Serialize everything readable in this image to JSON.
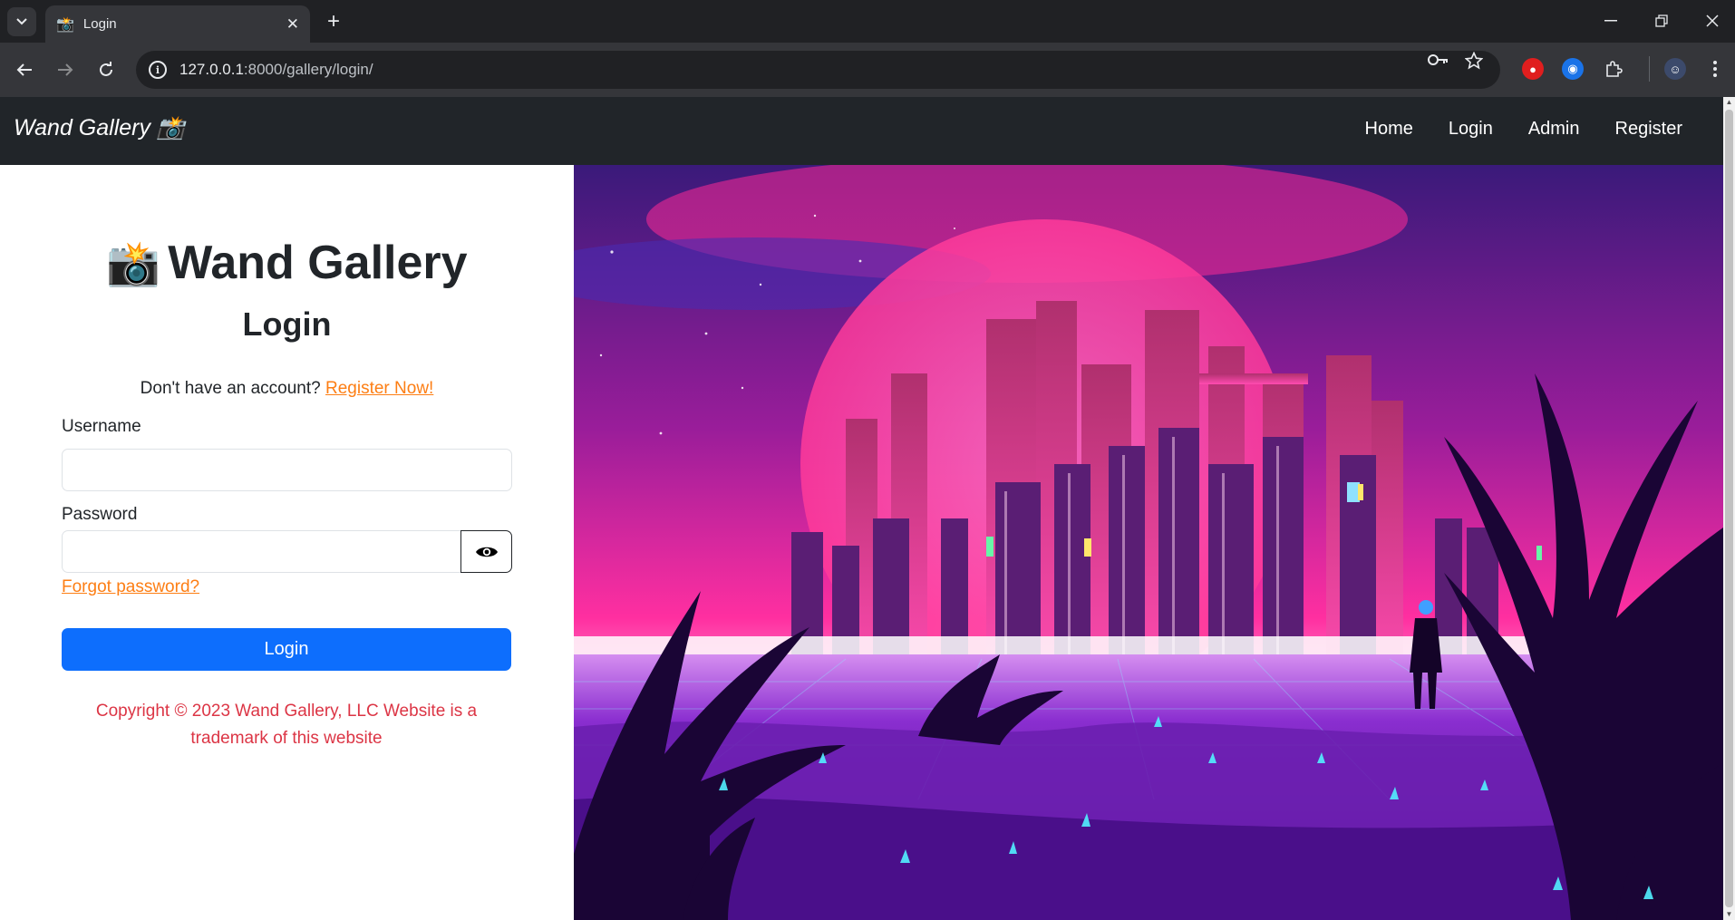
{
  "browser": {
    "tab_title": "Login",
    "tab_favicon": "📸",
    "url_host": "127.0.0.1",
    "url_path": ":8000/gallery/login/"
  },
  "navbar": {
    "brand": "Wand Gallery 📸",
    "links": [
      "Home",
      "Login",
      "Admin",
      "Register"
    ]
  },
  "login": {
    "title_icon": "📸",
    "title": "Wand Gallery",
    "subtitle": "Login",
    "register_prompt": "Don't have an account?",
    "register_link": "Register Now!",
    "username_label": "Username",
    "username_value": "",
    "password_label": "Password",
    "password_value": "",
    "forgot_link": "Forgot password?",
    "submit_label": "Login",
    "copyright": "Copyright © 2023 Wand Gallery, LLC Website is a trademark of this website"
  },
  "colors": {
    "navbar_bg": "#212529",
    "accent_link": "#fd7e14",
    "primary_button": "#0d6efd",
    "copyright_text": "#dc3545"
  }
}
